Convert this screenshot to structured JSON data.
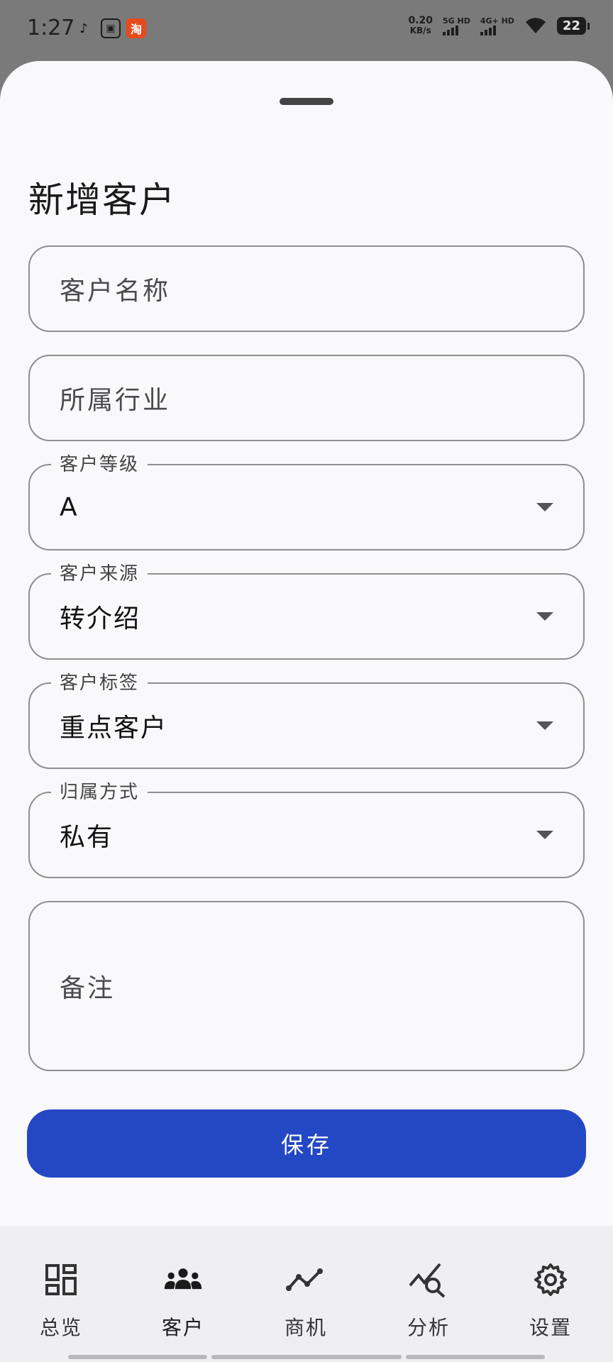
{
  "status_bar": {
    "time": "1:27",
    "net_speed_value": "0.20",
    "net_speed_unit": "KB/s",
    "signal_1": "5G HD",
    "signal_2": "4G+ HD",
    "battery": "22"
  },
  "sheet": {
    "title": "新增客户"
  },
  "form": {
    "customer_name_placeholder": "客户名称",
    "industry_placeholder": "所属行业",
    "level": {
      "label": "客户等级",
      "value": "A"
    },
    "source": {
      "label": "客户来源",
      "value": "转介绍"
    },
    "tag": {
      "label": "客户标签",
      "value": "重点客户"
    },
    "ownership": {
      "label": "归属方式",
      "value": "私有"
    },
    "notes_placeholder": "备注",
    "save_label": "保存"
  },
  "colors": {
    "primary": "#2447c4",
    "background": "#f9f9fb",
    "border": "#8e8e93"
  },
  "nav": {
    "items": [
      {
        "label": "总览",
        "icon": "dashboard-icon"
      },
      {
        "label": "客户",
        "icon": "people-icon"
      },
      {
        "label": "商机",
        "icon": "trend-line-icon"
      },
      {
        "label": "分析",
        "icon": "analytics-search-icon"
      },
      {
        "label": "设置",
        "icon": "gear-icon"
      }
    ],
    "active_index": 1
  }
}
